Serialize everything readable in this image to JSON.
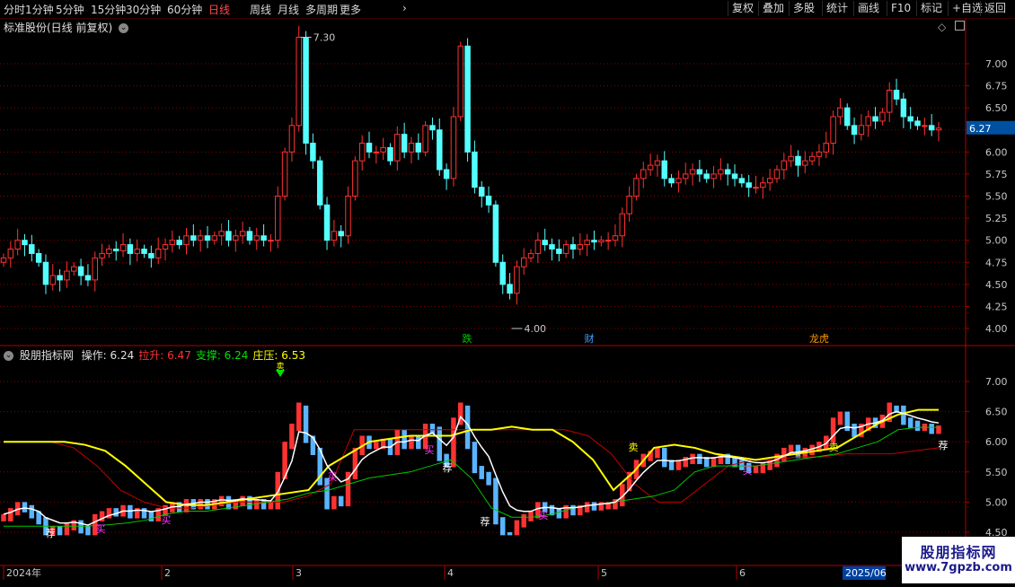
{
  "toolbar": {
    "periods": [
      "分时",
      "1分钟",
      "5分钟",
      "15分钟",
      "30分钟",
      "60分钟",
      "日线",
      "周线",
      "月线",
      "多周期",
      "更多"
    ],
    "active_period": "日线",
    "more_arrow": "›",
    "buttons": [
      "复权",
      "叠加",
      "多股",
      "统计",
      "画线",
      "F10",
      "标记",
      "+自选",
      "返回"
    ]
  },
  "main_chart": {
    "title": "标准股份(日线 前复权)",
    "dropdown_icon": "circle-chevron-icon",
    "current_price": "6.27",
    "y_ticks": [
      "7.00",
      "6.75",
      "6.50",
      "6.25",
      "6.00",
      "5.75",
      "5.50",
      "5.25",
      "5.00",
      "4.75",
      "4.50",
      "4.25",
      "4.00"
    ],
    "high_label": "7.30",
    "low_label": "4.00",
    "markers": [
      {
        "text": "跌",
        "color": "#00c800"
      },
      {
        "text": "财",
        "color": "#40a0ff"
      },
      {
        "text": "龙虎",
        "color": "#ff9900"
      }
    ]
  },
  "indicator": {
    "name": "股朋指标网",
    "fields": [
      {
        "label": "操作:",
        "value": "6.24",
        "color": "#e0e0e0"
      },
      {
        "label": "拉升:",
        "value": "6.47",
        "color": "#ff3232"
      },
      {
        "label": "支撑:",
        "value": "6.24",
        "color": "#00e000"
      },
      {
        "label": "庄压:",
        "value": "6.53",
        "color": "#ffff00"
      }
    ],
    "y_ticks": [
      "7.00",
      "6.50",
      "6.00",
      "5.50",
      "5.00",
      "4.50"
    ],
    "signal_labels": [
      {
        "text": "买",
        "color": "#ff33ff"
      },
      {
        "text": "荐",
        "color": "#ffffff"
      },
      {
        "text": "卖",
        "color": "#ffff00"
      }
    ]
  },
  "x_axis": {
    "labels": [
      "2024年",
      "2",
      "3",
      "4",
      "5",
      "6"
    ],
    "highlight": "2025/06"
  },
  "watermark": {
    "title": "股朋指标网",
    "url": "www.7gpzb.com"
  },
  "colors": {
    "up": "#ff3232",
    "down": "#54ffff",
    "bull_fill": "#000000",
    "bear_fill": "#54ffff",
    "grid": "#8b0000",
    "border": "#b00000",
    "ma_white": "#ffffff",
    "ma_yellow": "#ffff00",
    "ma_green": "#00c800",
    "ma_red": "#c80000",
    "bar_blue": "#5ab4ff"
  }
}
